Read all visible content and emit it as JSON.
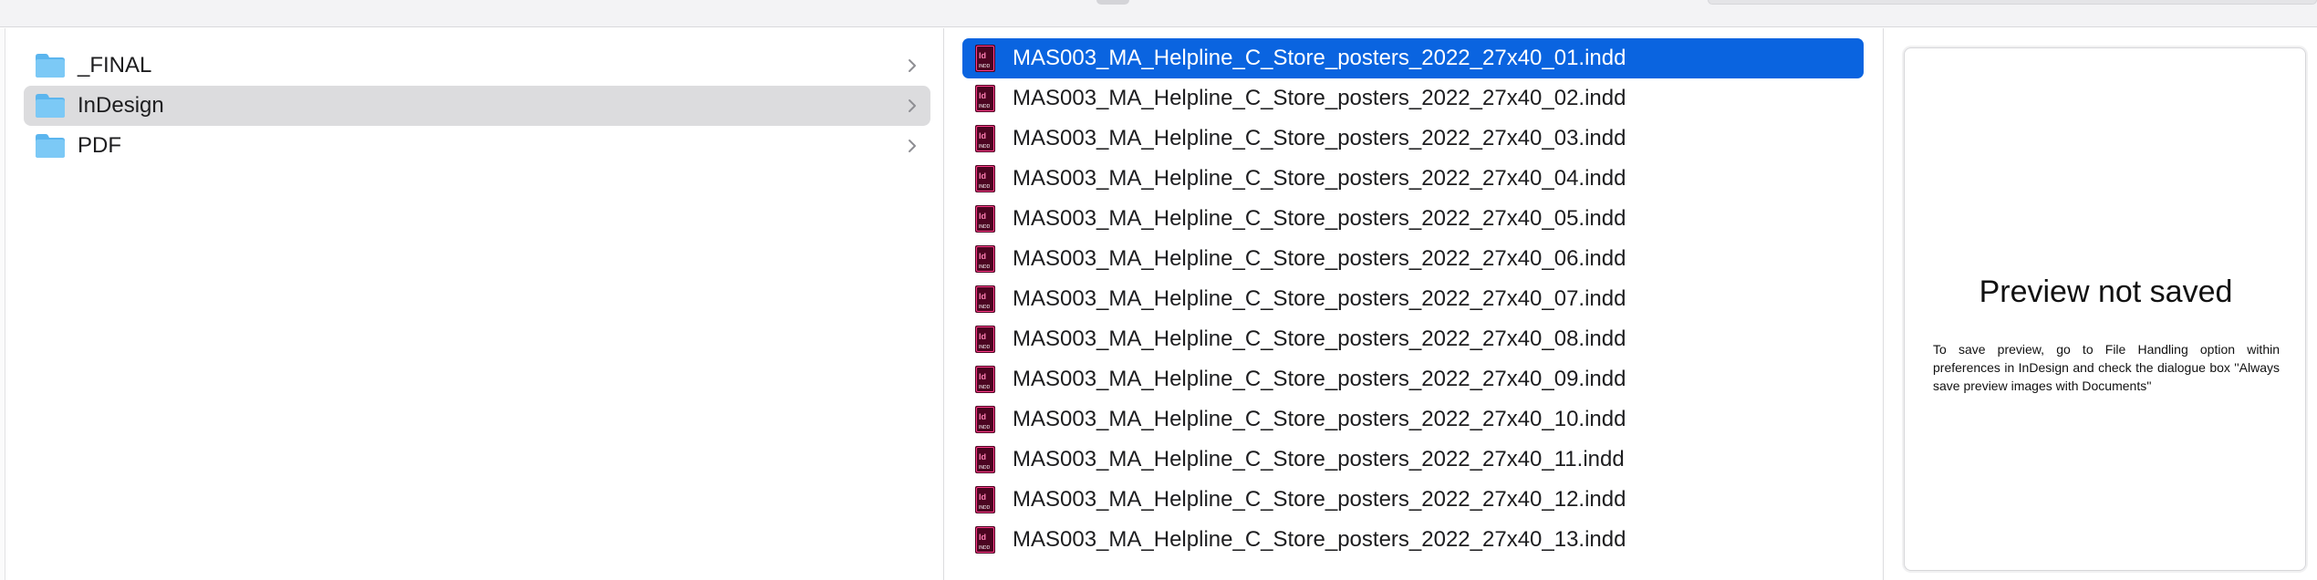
{
  "window": {
    "toolbar": {
      "view_segment_icon": "view-segment",
      "search_field_icon": "search-field"
    }
  },
  "colors": {
    "selection_blue": "#0a64e0",
    "folder_selected_bg": "#dcdcde",
    "indesign_icon": "#4b0420"
  },
  "folders": [
    {
      "label": "_FINAL",
      "icon": "folder-icon",
      "selected": false
    },
    {
      "label": "InDesign",
      "icon": "folder-icon",
      "selected": true
    },
    {
      "label": "PDF",
      "icon": "folder-icon",
      "selected": false
    }
  ],
  "files": [
    {
      "label": "MAS003_MA_Helpline_C_Store_posters_2022_27x40_01.indd",
      "icon": "indesign-file-icon",
      "selected": true
    },
    {
      "label": "MAS003_MA_Helpline_C_Store_posters_2022_27x40_02.indd",
      "icon": "indesign-file-icon",
      "selected": false
    },
    {
      "label": "MAS003_MA_Helpline_C_Store_posters_2022_27x40_03.indd",
      "icon": "indesign-file-icon",
      "selected": false
    },
    {
      "label": "MAS003_MA_Helpline_C_Store_posters_2022_27x40_04.indd",
      "icon": "indesign-file-icon",
      "selected": false
    },
    {
      "label": "MAS003_MA_Helpline_C_Store_posters_2022_27x40_05.indd",
      "icon": "indesign-file-icon",
      "selected": false
    },
    {
      "label": "MAS003_MA_Helpline_C_Store_posters_2022_27x40_06.indd",
      "icon": "indesign-file-icon",
      "selected": false
    },
    {
      "label": "MAS003_MA_Helpline_C_Store_posters_2022_27x40_07.indd",
      "icon": "indesign-file-icon",
      "selected": false
    },
    {
      "label": "MAS003_MA_Helpline_C_Store_posters_2022_27x40_08.indd",
      "icon": "indesign-file-icon",
      "selected": false
    },
    {
      "label": "MAS003_MA_Helpline_C_Store_posters_2022_27x40_09.indd",
      "icon": "indesign-file-icon",
      "selected": false
    },
    {
      "label": "MAS003_MA_Helpline_C_Store_posters_2022_27x40_10.indd",
      "icon": "indesign-file-icon",
      "selected": false
    },
    {
      "label": "MAS003_MA_Helpline_C_Store_posters_2022_27x40_11.indd",
      "icon": "indesign-file-icon",
      "selected": false
    },
    {
      "label": "MAS003_MA_Helpline_C_Store_posters_2022_27x40_12.indd",
      "icon": "indesign-file-icon",
      "selected": false
    },
    {
      "label": "MAS003_MA_Helpline_C_Store_posters_2022_27x40_13.indd",
      "icon": "indesign-file-icon",
      "selected": false
    }
  ],
  "preview": {
    "title": "Preview not saved",
    "body": "To save preview, go to File Handling option within preferences in InDesign and check the dialogue box ''Always save preview images with Documents''"
  }
}
